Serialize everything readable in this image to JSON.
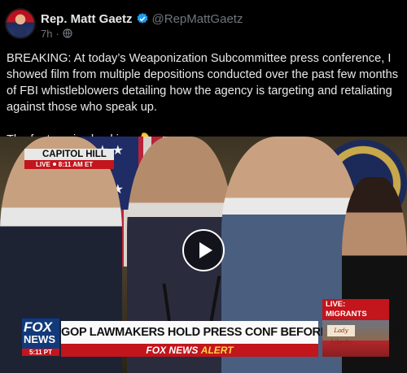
{
  "tweet": {
    "author_name": "Rep. Matt Gaetz",
    "handle": "@RepMattGaetz",
    "timestamp": "7h",
    "separator": "·",
    "body_p1": "BREAKING: At today’s Weaponization Subcommittee press conference, I showed film from multiple depositions conducted over the past few months of FBI whistleblowers detailing how the agency is targeting and retaliating against those who speak up.",
    "body_p2": "The footage is shocking. 👇"
  },
  "icons": {
    "verified": "verified-badge-icon",
    "audience": "globe-icon",
    "play": "play-icon"
  },
  "video": {
    "location_banner": "CAPITOL HILL",
    "live_label": "LIVE",
    "live_time": "8:11 AM ET",
    "network_line1": "FOX",
    "network_line2": "NEWS",
    "network_time": "5:11 PT",
    "headline": "GOP LAWMAKERS HOLD PRESS CONF BEFORE FBI HEARING",
    "alert_brand": "FOX NEWS",
    "alert_word": "ALERT",
    "side_live": "LIVE: MIGRANTS ARRIVE IN NYC",
    "side_sign": "Lady Liberty"
  },
  "colors": {
    "background": "#000000",
    "text": "#e7e9ea",
    "secondary_text": "#71767b",
    "verified": "#1d9bf0",
    "fox_red": "#c2151c",
    "fox_blue": "#123a7a"
  }
}
